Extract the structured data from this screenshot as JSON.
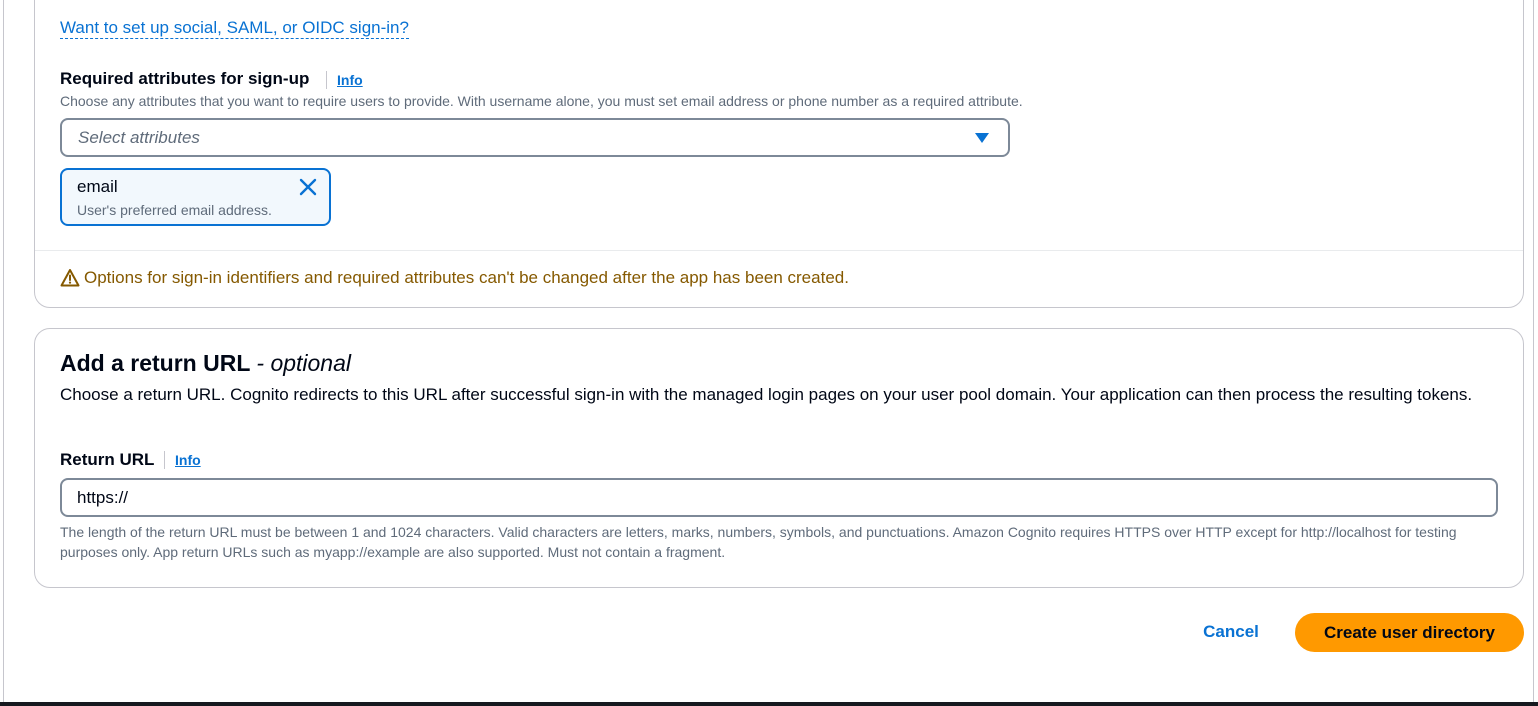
{
  "colors": {
    "link": "#0972d3",
    "warning": "#855900",
    "primary_button": "#ff9900",
    "token_background": "#f2f8fd"
  },
  "sign_in": {
    "social_link": "Want to set up social, SAML, or OIDC sign-in?"
  },
  "required_attributes": {
    "label": "Required attributes for sign-up",
    "info": "Info",
    "description": "Choose any attributes that you want to require users to provide. With username alone, you must set email address or phone number as a required attribute.",
    "select_placeholder": "Select attributes",
    "dropdown_icon": "caret-down-icon",
    "selected": [
      {
        "name": "email",
        "description": "User's preferred email address.",
        "dismiss_icon": "close-icon"
      }
    ]
  },
  "warning": {
    "icon": "warning-icon",
    "text": "Options for sign-in identifiers and required attributes can't be changed after the app has been created."
  },
  "return_url": {
    "title": "Add a return URL",
    "title_suffix": "optional",
    "description": "Choose a return URL. Cognito redirects to this URL after successful sign-in with the managed login pages on your user pool domain. Your application can then process the resulting tokens.",
    "label": "Return URL",
    "info": "Info",
    "value": "https://",
    "constraint": "The length of the return URL must be between 1 and 1024 characters. Valid characters are letters, marks, numbers, symbols, and punctuations. Amazon Cognito requires HTTPS over HTTP except for http://localhost for testing purposes only. App return URLs such as myapp://example are also supported. Must not contain a fragment."
  },
  "actions": {
    "cancel": "Cancel",
    "create": "Create user directory"
  }
}
